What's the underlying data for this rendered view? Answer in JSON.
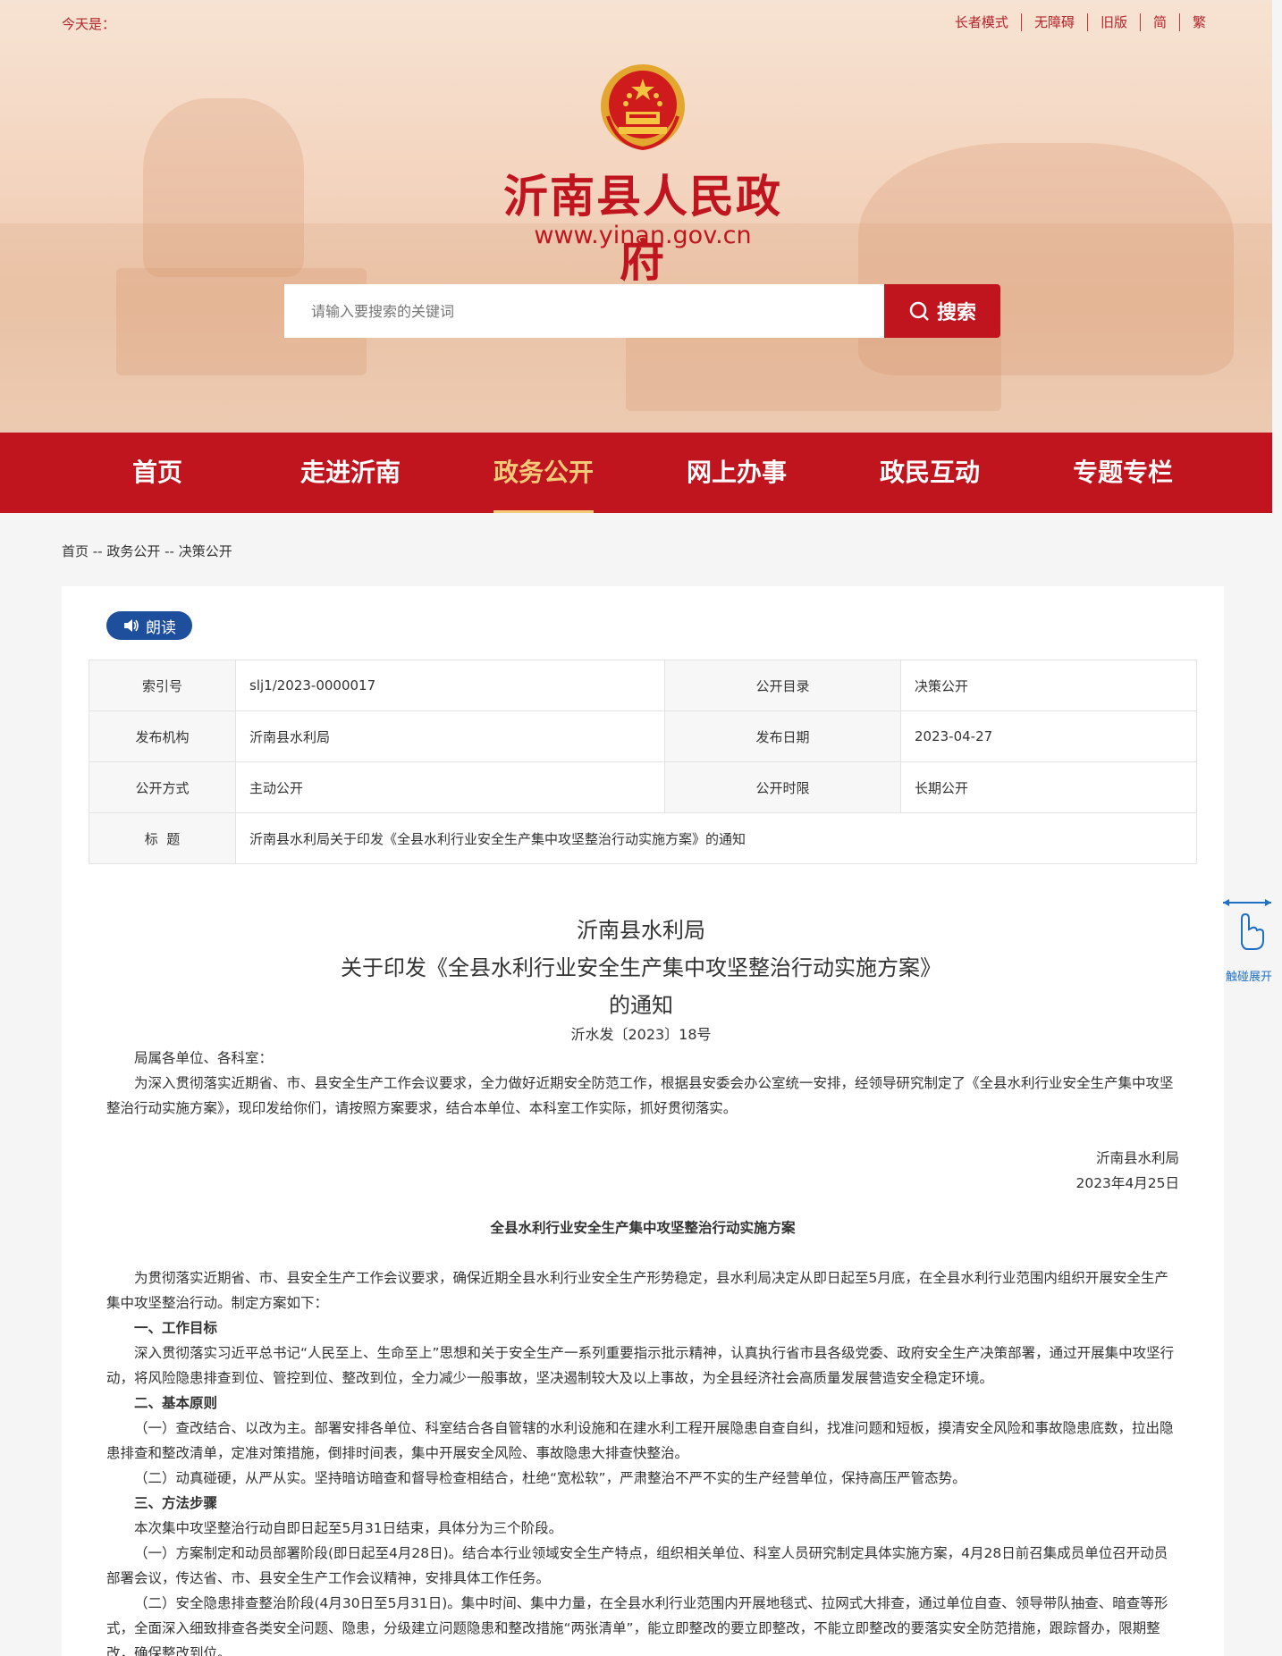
{
  "topbar": {
    "today": "今天是：",
    "links": [
      "长者模式",
      "无障碍",
      "旧版",
      "简",
      "繁"
    ]
  },
  "site": {
    "title": "沂南县人民政府",
    "url": "www.yinan.gov.cn"
  },
  "search": {
    "placeholder": "请输入要搜索的关键词",
    "button": "搜索"
  },
  "nav": [
    "首页",
    "走进沂南",
    "政务公开",
    "网上办事",
    "政民互动",
    "专题专栏"
  ],
  "breadcrumb": "首页 -- 政务公开 -- 决策公开",
  "read_button": "朗读",
  "meta": {
    "rows": [
      {
        "k1": "索引号",
        "v1": "slj1/2023-0000017",
        "k2": "公开目录",
        "v2": "决策公开"
      },
      {
        "k1": "发布机构",
        "v1": "沂南县水利局",
        "k2": "发布日期",
        "v2": "2023-04-27"
      },
      {
        "k1": "公开方式",
        "v1": "主动公开",
        "k2": "公开时限",
        "v2": "长期公开"
      }
    ],
    "title_key": "标  题",
    "title_value": "沂南县水利局关于印发《全县水利行业安全生产集中攻坚整治行动实施方案》的通知"
  },
  "doc": {
    "title_line1": "沂南县水利局",
    "title_line2": "关于印发《全县水利行业安全生产集中攻坚整治行动实施方案》",
    "title_line3": "的通知",
    "number": "沂水发〔2023〕18号",
    "greeting": "局属各单位、各科室：",
    "intro": "为深入贯彻落实近期省、市、县安全生产工作会议要求，全力做好近期安全防范工作，根据县安委会办公室统一安排，经领导研究制定了《全县水利行业安全生产集中攻坚整治行动实施方案》，现印发给你们，请按照方案要求，结合本单位、本科室工作实际，抓好贯彻落实。",
    "sign_org": "沂南县水利局",
    "sign_date": "2023年4月25日",
    "plan_title": "全县水利行业安全生产集中攻坚整治行动实施方案",
    "p1": "为贯彻落实近期省、市、县安全生产工作会议要求，确保近期全县水利行业安全生产形势稳定，县水利局决定从即日起至5月底，在全县水利行业范围内组织开展安全生产集中攻坚整治行动。制定方案如下：",
    "h1": "一、工作目标",
    "p2": "深入贯彻落实习近平总书记“人民至上、生命至上”思想和关于安全生产一系列重要指示批示精神，认真执行省市县各级党委、政府安全生产决策部署，通过开展集中攻坚行动，将风险隐患排查到位、管控到位、整改到位，全力减少一般事故，坚决遏制较大及以上事故，为全县经济社会高质量发展营造安全稳定环境。",
    "h2": "二、基本原则",
    "p3": "（一）查改结合、以改为主。部署安排各单位、科室结合各自管辖的水利设施和在建水利工程开展隐患自查自纠，找准问题和短板，摸清安全风险和事故隐患底数，拉出隐患排查和整改清单，定准对策措施，倒排时间表，集中开展安全风险、事故隐患大排查快整治。",
    "p4": "（二）动真碰硬，从严从实。坚持暗访暗查和督导检查相结合，杜绝“宽松软”，严肃整治不严不实的生产经营单位，保持高压严管态势。",
    "h3": "三、方法步骤",
    "p5": "本次集中攻坚整治行动自即日起至5月31日结束，具体分为三个阶段。",
    "p6": "（一）方案制定和动员部署阶段(即日起至4月28日)。结合本行业领域安全生产特点，组织相关单位、科室人员研究制定具体实施方案，4月28日前召集成员单位召开动员部署会议，传达省、市、县安全生产工作会议精神，安排具体工作任务。",
    "p7": "（二）安全隐患排查整治阶段(4月30日至5月31日)。集中时间、集中力量，在全县水利行业范围内开展地毯式、拉网式大排查，通过单位自查、领导带队抽查、暗查等形式，全面深入细致排查各类安全问题、隐患，分级建立问题隐患和整改措施“两张清单”，能立即整改的要立即整改，不能立即整改的要落实安全防范措施，跟踪督办，限期整改，确保整改到位。"
  },
  "side_widget": "触碰展开"
}
